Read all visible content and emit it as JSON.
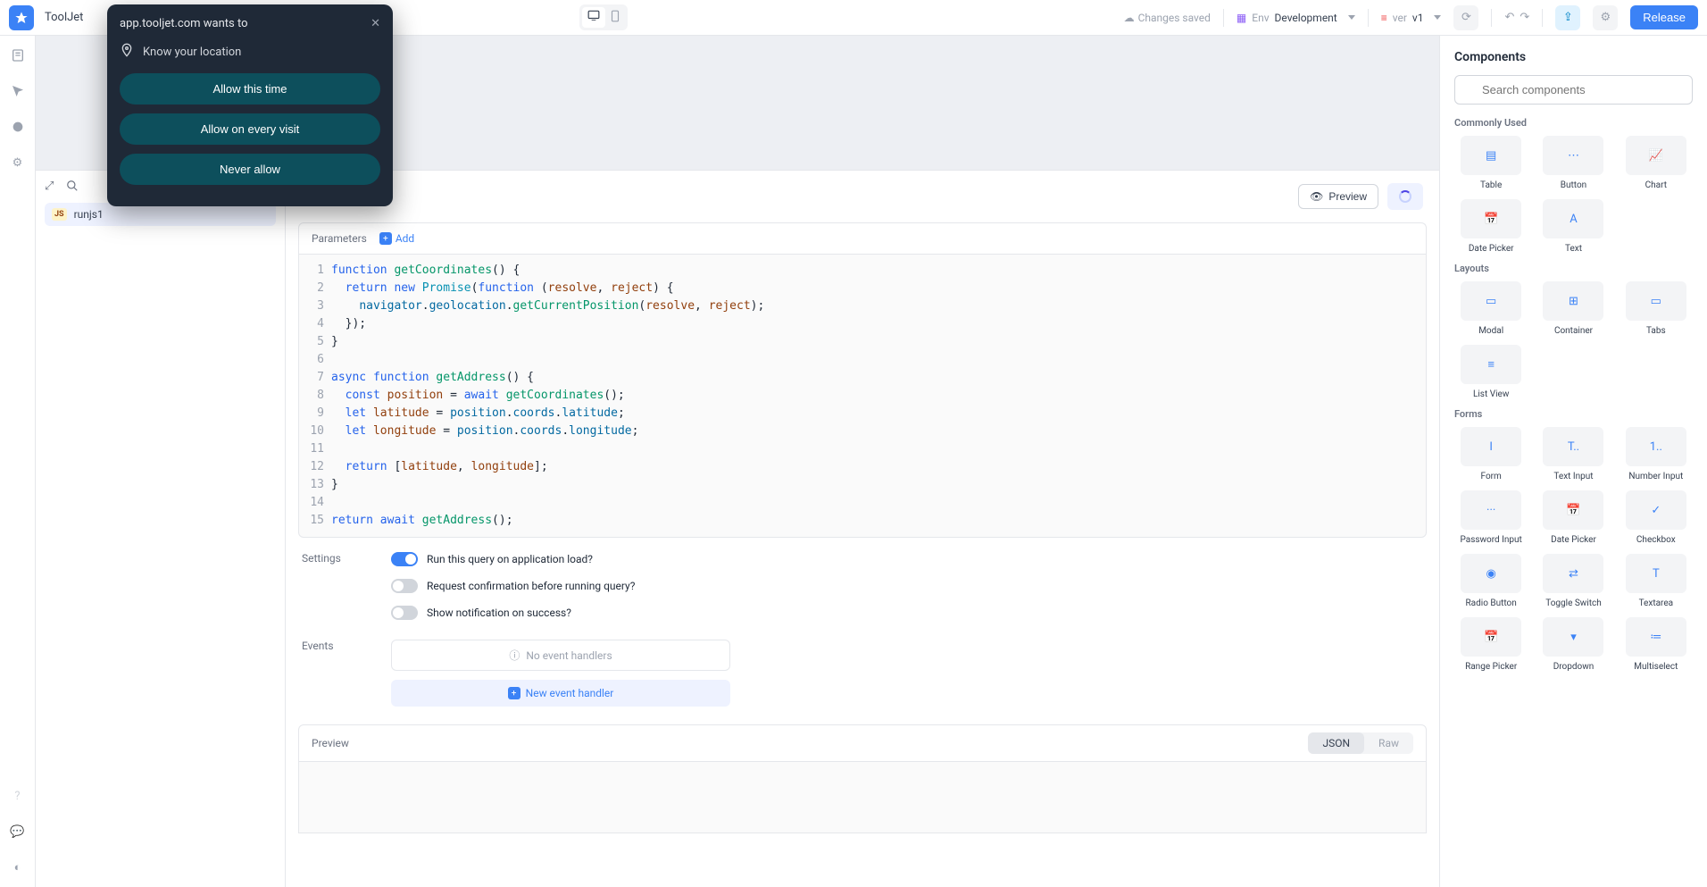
{
  "header": {
    "app_name": "ToolJet",
    "changes_saved": "Changes saved",
    "env_label": "Env",
    "env_value": "Development",
    "ver_label": "ver",
    "ver_value": "v1",
    "release": "Release"
  },
  "permission": {
    "title": "app.tooljet.com wants to",
    "request": "Know your location",
    "allow_once": "Allow this time",
    "allow_always": "Allow on every visit",
    "never": "Never allow"
  },
  "query": {
    "item_name": "runjs1",
    "parameters_label": "Parameters",
    "add_label": "Add",
    "preview_button": "Preview",
    "code_lines": [
      "<span class='kw'>function</span> <span class='fn'>getCoordinates</span>() {",
      "  <span class='kw'>return</span> <span class='kw'>new</span> <span class='cls'>Promise</span>(<span class='kw'>function</span> (<span class='id'>resolve</span>, <span class='id'>reject</span>) {",
      "    <span class='prop'>navigator</span>.<span class='prop'>geolocation</span>.<span class='fn'>getCurrentPosition</span>(<span class='id'>resolve</span>, <span class='id'>reject</span>);",
      "  });",
      "}",
      "",
      "<span class='kw'>async</span> <span class='kw'>function</span> <span class='fn'>getAddress</span>() {",
      "  <span class='kw'>const</span> <span class='id'>position</span> = <span class='kw'>await</span> <span class='fn'>getCoordinates</span>();",
      "  <span class='kw'>let</span> <span class='id'>latitude</span> = <span class='prop'>position</span>.<span class='prop'>coords</span>.<span class='prop'>latitude</span>;",
      "  <span class='kw'>let</span> <span class='id'>longitude</span> = <span class='prop'>position</span>.<span class='prop'>coords</span>.<span class='prop'>longitude</span>;",
      "",
      "  <span class='kw'>return</span> [<span class='id'>latitude</span>, <span class='id'>longitude</span>];",
      "}",
      "",
      "<span class='kw'>return</span> <span class='kw'>await</span> <span class='fn'>getAddress</span>();"
    ],
    "settings_label": "Settings",
    "settings": [
      {
        "label": "Run this query on application load?",
        "on": true
      },
      {
        "label": "Request confirmation before running query?",
        "on": false
      },
      {
        "label": "Show notification on success?",
        "on": false
      }
    ],
    "events_label": "Events",
    "no_handlers": "No event handlers",
    "new_handler": "New event handler",
    "preview_label": "Preview",
    "preview_tabs": {
      "json": "JSON",
      "raw": "Raw"
    }
  },
  "right_panel": {
    "title": "Components",
    "search_placeholder": "Search components",
    "sections": [
      {
        "name": "Commonly Used",
        "items": [
          "Table",
          "Button",
          "Chart",
          "Date Picker",
          "Text"
        ]
      },
      {
        "name": "Layouts",
        "items": [
          "Modal",
          "Container",
          "Tabs",
          "List View"
        ]
      },
      {
        "name": "Forms",
        "items": [
          "Form",
          "Text Input",
          "Number Input",
          "Password Input",
          "Date Picker",
          "Checkbox",
          "Radio Button",
          "Toggle Switch",
          "Textarea",
          "Range Picker",
          "Dropdown",
          "Multiselect"
        ]
      }
    ]
  }
}
